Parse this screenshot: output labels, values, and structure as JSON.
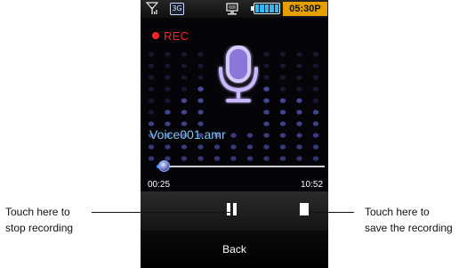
{
  "status_bar": {
    "signal_icon": "signal-bars-icon",
    "network_badge": "3G",
    "pc_icon": "pc-connection-icon",
    "battery_level": 1.0,
    "time": "05:30P"
  },
  "recorder": {
    "state_label": "REC",
    "file_name": "Voice001.amr",
    "elapsed": "00:25",
    "total": "10:52",
    "progress_fraction": 0.02,
    "mic_icon": "microphone-icon"
  },
  "controls": {
    "pause_icon": "pause-icon",
    "stop_icon": "stop-icon",
    "back_label": "Back"
  },
  "annotations": {
    "left_line1": "Touch here to",
    "left_line2": "stop recording",
    "right_line1": "Touch here to",
    "right_line2": "save the recording"
  },
  "colors": {
    "accent_blue": "#79c5f0",
    "rec_red": "#ff2222",
    "clock_bg": "#e5a000",
    "battery": "#39b5f0"
  }
}
